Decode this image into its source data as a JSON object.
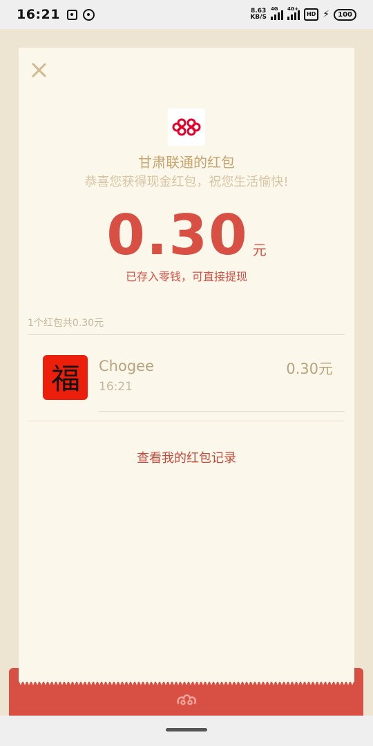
{
  "status_bar": {
    "time": "16:21",
    "net_speed_value": "8.63",
    "net_speed_unit": "KB/S",
    "sim1_tag": "4G",
    "sim2_tag": "4G+",
    "hd_label": "HD",
    "battery": "100"
  },
  "packet": {
    "sender_title": "甘肃联通的红包",
    "greeting": "恭喜您获得现金红包，祝您生活愉快!",
    "amount": "0.30",
    "amount_unit": "元",
    "deposit_note": "已存入零钱，可直接提现",
    "summary": "1个红包共0.30元"
  },
  "records": [
    {
      "name": "Chogee",
      "time": "16:21",
      "amount": "0.30元",
      "avatar_char": "福"
    }
  ],
  "history_link": "查看我的红包记录",
  "colors": {
    "accent_red": "#d84f43",
    "gold": "#c8a46e",
    "card_bg": "#fbf7ea",
    "page_bg": "#ede4d2",
    "logo_red": "#e4002b"
  },
  "icons": {
    "close": "close-icon",
    "logo": "china-unicom-logo",
    "emblem": "auspicious-cloud-icon"
  }
}
